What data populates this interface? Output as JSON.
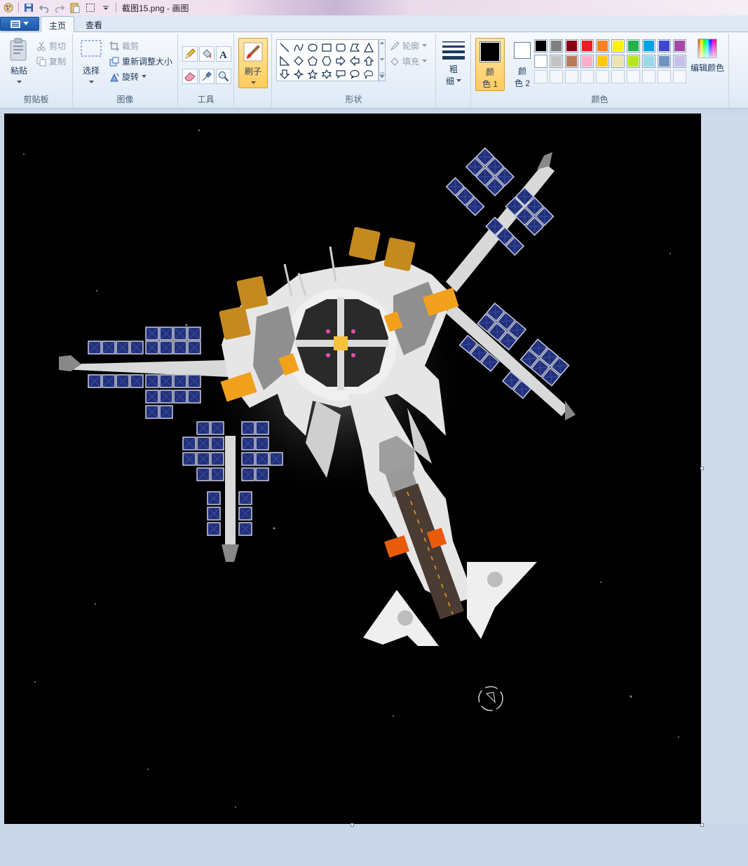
{
  "titlebar": {
    "title": "截图15.png - 画图",
    "quick_access": [
      "paint-app-icon",
      "save-icon",
      "undo-icon",
      "redo-icon",
      "paste-icon",
      "select-icon",
      "customize-dropdown-icon"
    ]
  },
  "tabs": [
    {
      "label": "主页",
      "active": true
    },
    {
      "label": "查看",
      "active": false
    }
  ],
  "ribbon": {
    "clipboard": {
      "paste_label": "粘贴",
      "cut_label": "剪切",
      "copy_label": "复制",
      "group_label": "剪贴板"
    },
    "image": {
      "select_label": "选择",
      "crop_label": "裁剪",
      "resize_label": "重新调整大小",
      "rotate_label": "旋转",
      "group_label": "图像"
    },
    "tools": {
      "items": [
        "pencil-icon",
        "fill-bucket-icon",
        "text-icon",
        "eraser-icon",
        "color-picker-icon",
        "magnifier-icon"
      ],
      "group_label": "工具"
    },
    "brush": {
      "label": "刷子"
    },
    "shapes": {
      "outline_label": "轮廓",
      "fill_label": "填充",
      "group_label": "形状"
    },
    "size": {
      "label_line1": "粗",
      "label_line2": "细"
    },
    "colors": {
      "color1_line1": "颜",
      "color1_line2": "色 1",
      "color2_line1": "颜",
      "color2_line2": "色 2",
      "edit_label": "编辑颜色",
      "group_label": "颜色",
      "color1_value": "#000000",
      "color2_value": "#ffffff",
      "palette_row1": [
        "#000000",
        "#7f7f7f",
        "#880015",
        "#ed1c24",
        "#ff7f27",
        "#fff200",
        "#22b14c",
        "#00a2e8",
        "#3f48cc",
        "#a349a4"
      ],
      "palette_row2": [
        "#ffffff",
        "#c3c3c3",
        "#b97a57",
        "#ffaec9",
        "#ffc90e",
        "#efe4b0",
        "#b5e61d",
        "#99d9ea",
        "#7092be",
        "#c8bfe7"
      ]
    }
  },
  "canvas": {
    "image_name": "space-station-screenshot"
  }
}
